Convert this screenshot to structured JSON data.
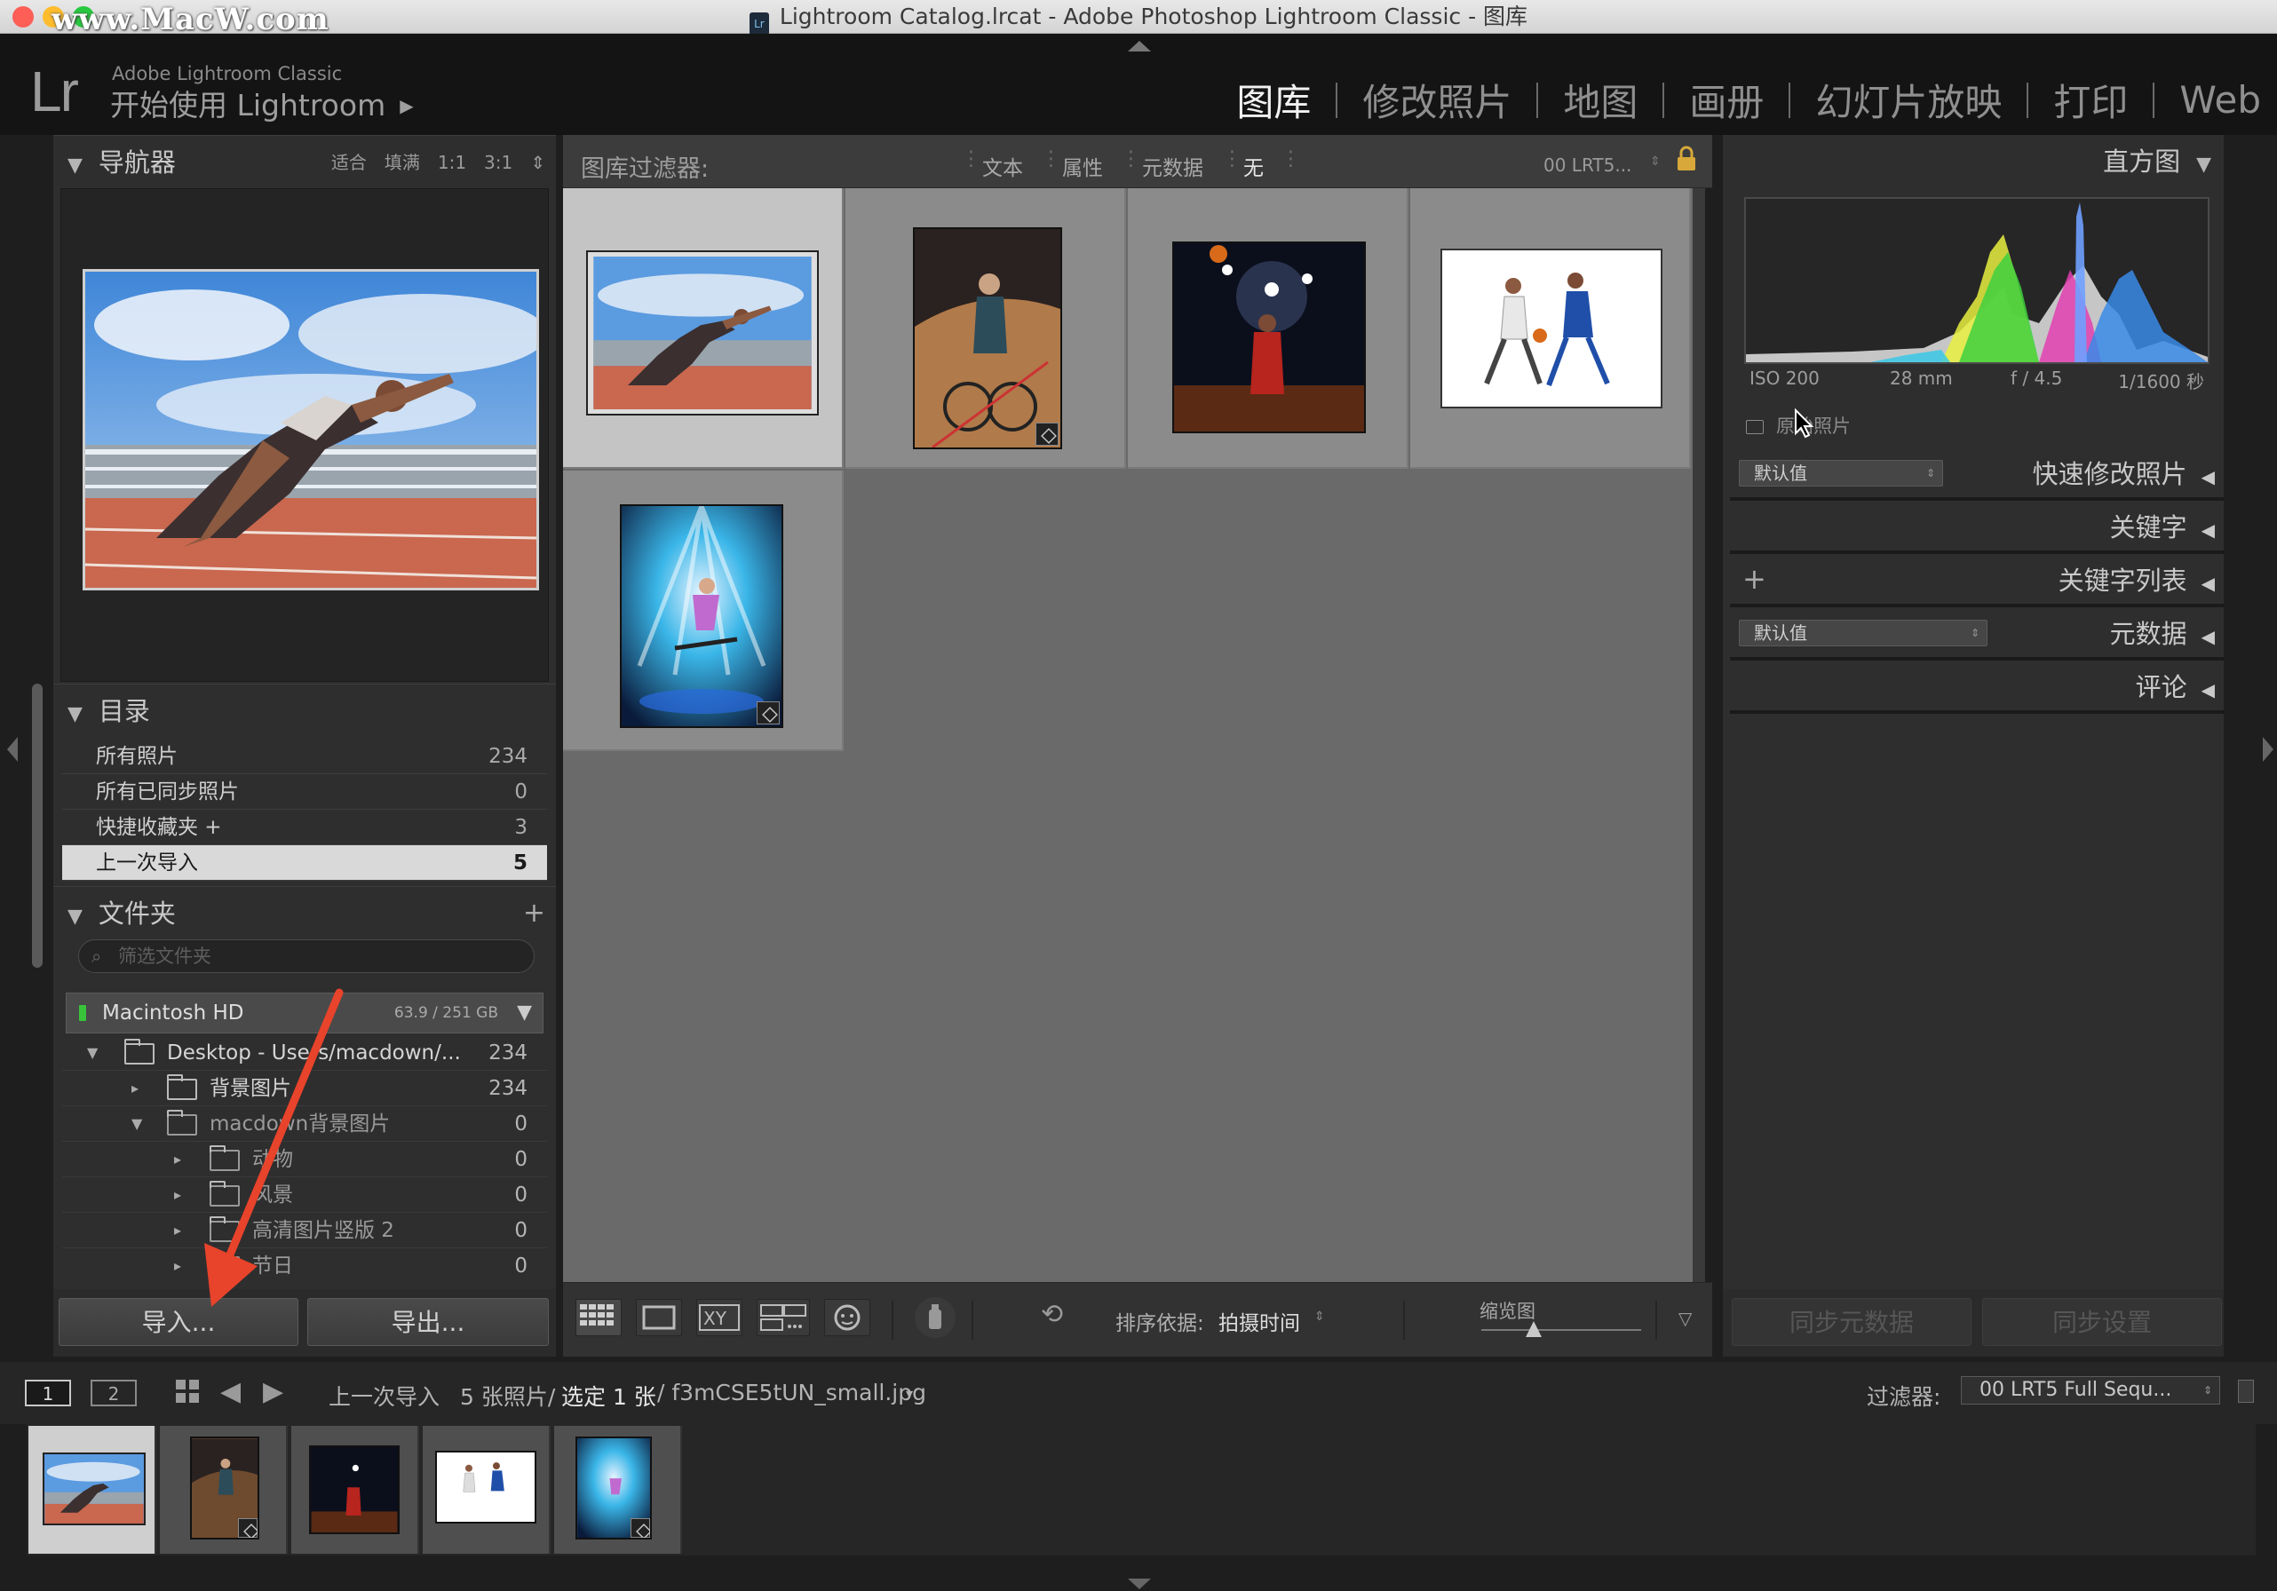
{
  "window": {
    "title": "Lightroom Catalog.lrcat - Adobe Photoshop Lightroom Classic - 图库",
    "lr_badge": "Lr",
    "watermark": "www.MacW.com"
  },
  "identity": {
    "logo": "Lr",
    "product": "Adobe Lightroom Classic",
    "subtitle": "开始使用 Lightroom"
  },
  "modules": [
    "图库",
    "修改照片",
    "地图",
    "画册",
    "幻灯片放映",
    "打印",
    "Web"
  ],
  "navigator": {
    "title": "导航器",
    "options": [
      "适合",
      "填满",
      "1:1",
      "3:1"
    ]
  },
  "catalog": {
    "title": "目录",
    "items": [
      {
        "label": "所有照片",
        "count": "234"
      },
      {
        "label": "所有已同步照片",
        "count": "0"
      },
      {
        "label": "快捷收藏夹 +",
        "count": "3"
      },
      {
        "label": "上一次导入",
        "count": "5"
      }
    ]
  },
  "folders": {
    "title": "文件夹",
    "add": "+",
    "filter_placeholder": "筛选文件夹",
    "volume": {
      "name": "Macintosh HD",
      "space": "63.9 / 251 GB"
    },
    "items": [
      {
        "label": "Desktop - Users/macdown/...",
        "count": "234"
      },
      {
        "label": "背景图片",
        "count": "234"
      },
      {
        "label": "macdown背景图片",
        "count": "0"
      },
      {
        "label": "动物",
        "count": "0"
      },
      {
        "label": "风景",
        "count": "0"
      },
      {
        "label": "高清图片竖版 2",
        "count": "0"
      },
      {
        "label": "节日",
        "count": "0"
      }
    ]
  },
  "left_buttons": {
    "import": "导入...",
    "export": "导出..."
  },
  "filterbar": {
    "label": "图库过滤器:",
    "options": [
      "文本",
      "属性",
      "元数据",
      "无"
    ],
    "preset": "00 LRT5..."
  },
  "toolbar": {
    "sort_label": "排序依据:",
    "sort_value": "拍摄时间",
    "thumb_label": "缩览图",
    "thumbnail_size": 0.33
  },
  "histogram": {
    "title": "直方图",
    "iso": "ISO 200",
    "focal": "28 mm",
    "aperture": "f / 4.5",
    "shutter": "1/1600 秒",
    "original": "原始照片"
  },
  "right_panels": [
    {
      "label": "快速修改照片",
      "preset": "默认值"
    },
    {
      "label": "关键字"
    },
    {
      "label": "关键字列表",
      "add": "+"
    },
    {
      "label": "元数据",
      "preset": "默认值"
    },
    {
      "label": "评论"
    }
  ],
  "right_buttons": {
    "sync_meta": "同步元数据",
    "sync_settings": "同步设置"
  },
  "filmstrip_bar": {
    "page1": "1",
    "page2": "2",
    "source": "上一次导入",
    "count": "5 张照片/",
    "selected": "选定 1 张",
    "filename": "/ f3mCSE5tUN_small.jpg",
    "filter_label": "过滤器:",
    "filter_value": "00 LRT5 Full Sequ..."
  },
  "colors": {
    "accent": "#f2f2f2",
    "panel": "#2e2e2e",
    "grid": "#6a6a6a",
    "selected_cell": "#c4c4c4",
    "arrow": "#e8432b"
  }
}
